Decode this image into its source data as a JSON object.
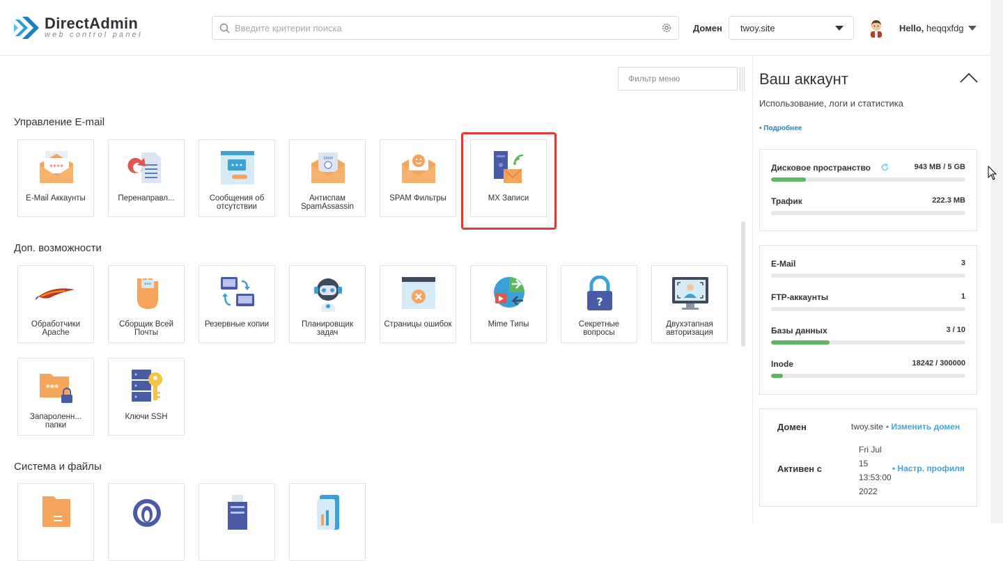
{
  "header": {
    "logo_title": "DirectAdmin",
    "logo_sub": "web control panel",
    "search_placeholder": "Введите критерии поиска",
    "domain_label": "Домен",
    "domain_value": "twoy.site",
    "user_greeting": "Hello,",
    "user_name": "heqqxfdg"
  },
  "main": {
    "filter_placeholder": "Фильтр меню",
    "sections": [
      {
        "title": "Управление E-mail",
        "tiles": [
          {
            "label": "E-Mail Аккаунты",
            "icon": "email-accounts-icon"
          },
          {
            "label": "Перенаправл...",
            "icon": "forwarders-icon"
          },
          {
            "label": "Сообщения об отсутствии",
            "icon": "autoresponder-icon"
          },
          {
            "label": "Антиспам SpamAssassin",
            "icon": "spamassassin-icon"
          },
          {
            "label": "SPAM Фильтры",
            "icon": "spam-filters-icon"
          },
          {
            "label": "MX Записи",
            "icon": "mx-records-icon"
          }
        ]
      },
      {
        "title": "Доп. возможности",
        "tiles": [
          {
            "label": "Обработчики Apache",
            "icon": "apache-feather-icon"
          },
          {
            "label": "Сборщик Всей Почты",
            "icon": "catch-all-hand-icon"
          },
          {
            "label": "Резервные копии",
            "icon": "backup-monitors-icon"
          },
          {
            "label": "Планировщик задач",
            "icon": "cron-robot-icon"
          },
          {
            "label": "Страницы ошибок",
            "icon": "error-pages-icon"
          },
          {
            "label": "Mime Типы",
            "icon": "mime-types-icon"
          },
          {
            "label": "Секретные вопросы",
            "icon": "security-lock-icon"
          },
          {
            "label": "Двухэтапная авторизация",
            "icon": "two-step-auth-icon"
          },
          {
            "label": "Запароленн... папки",
            "icon": "protected-folder-icon"
          },
          {
            "label": "Ключи SSH",
            "icon": "ssh-keys-icon"
          }
        ]
      },
      {
        "title": "Система и файлы",
        "tiles": [
          {
            "label": "",
            "icon": "file-folder-icon"
          },
          {
            "label": "",
            "icon": "onion-icon"
          },
          {
            "label": "",
            "icon": "server-icon"
          },
          {
            "label": "",
            "icon": "stats-icon"
          }
        ]
      }
    ]
  },
  "sidebar": {
    "title": "Ваш аккаунт",
    "subtitle": "Использование, логи и статистика",
    "more_link": "• Подробнее",
    "usage": [
      {
        "name": "Дисковое пространство",
        "value": "943 MB / 5 GB",
        "fraction": 0.18
      },
      {
        "name": "Трафик",
        "value": "222.3 MB",
        "fraction": 0.0
      }
    ],
    "counts": [
      {
        "name": "E-Mail",
        "value": "3",
        "fraction": 0.0
      },
      {
        "name": "FTP-аккаунты",
        "value": "1",
        "fraction": 0.0
      },
      {
        "name": "Базы данных",
        "value": "3 / 10",
        "fraction": 0.3
      },
      {
        "name": "Inode",
        "value": "18242 / 300000",
        "fraction": 0.06
      }
    ],
    "info": {
      "domain_key": "Домен",
      "domain_val": "twoy.site",
      "domain_link": "• Изменить домен",
      "active_key": "Активен с",
      "active_lines": [
        "Fri Jul",
        "15",
        "13:53:00",
        "2022"
      ],
      "profile_link": "• Настр. профиля"
    }
  },
  "colors": {
    "accent": "#2f7fb5",
    "link": "#42a5d8",
    "progress": "#5cb85c",
    "highlight": "#e53935"
  }
}
